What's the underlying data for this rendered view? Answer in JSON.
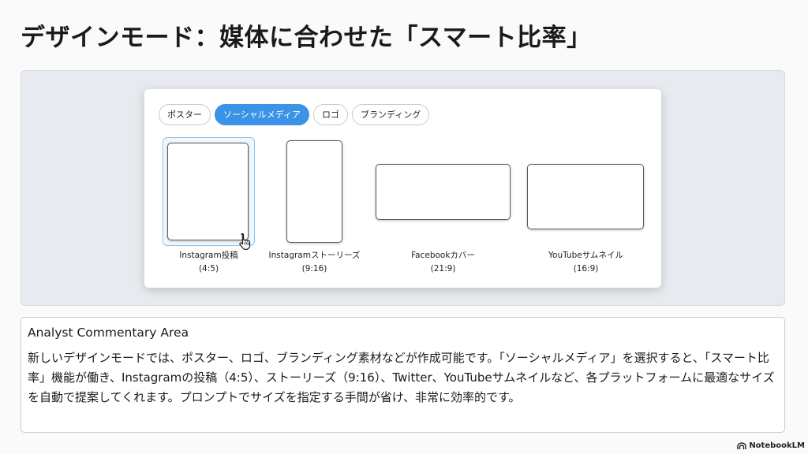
{
  "slide": {
    "title": "デザインモード：媒体に合わせた「スマート比率」"
  },
  "design_panel": {
    "tabs": [
      {
        "label": "ポスター",
        "active": false
      },
      {
        "label": "ソーシャルメディア",
        "active": true
      },
      {
        "label": "ロゴ",
        "active": false
      },
      {
        "label": "ブランディング",
        "active": false
      }
    ],
    "options": [
      {
        "name": "Instagram投稿",
        "ratio": "(4:5)",
        "selected": true
      },
      {
        "name": "Instagramストーリーズ",
        "ratio": "(9:16)",
        "selected": false
      },
      {
        "name": "Facebookカバー",
        "ratio": "(21:9)",
        "selected": false
      },
      {
        "name": "YouTubeサムネイル",
        "ratio": "(16:9)",
        "selected": false
      }
    ],
    "accent_color": "#3a93e6"
  },
  "commentary": {
    "heading": "Analyst Commentary Area",
    "body": "新しいデザインモードでは、ポスター、ロゴ、ブランディング素材などが作成可能です。「ソーシャルメディア」を選択すると、「スマート比率」機能が働き、Instagramの投稿（4:5）、ストーリーズ（9:16）、Twitter、YouTubeサムネイルなど、各プラットフォームに最適なサイズを自動で提案してくれます。プロンプトでサイズを指定する手間が省け、非常に効率的です。"
  },
  "branding": {
    "text": "NotebookLM",
    "icon": "notebooklm-logo-icon"
  }
}
